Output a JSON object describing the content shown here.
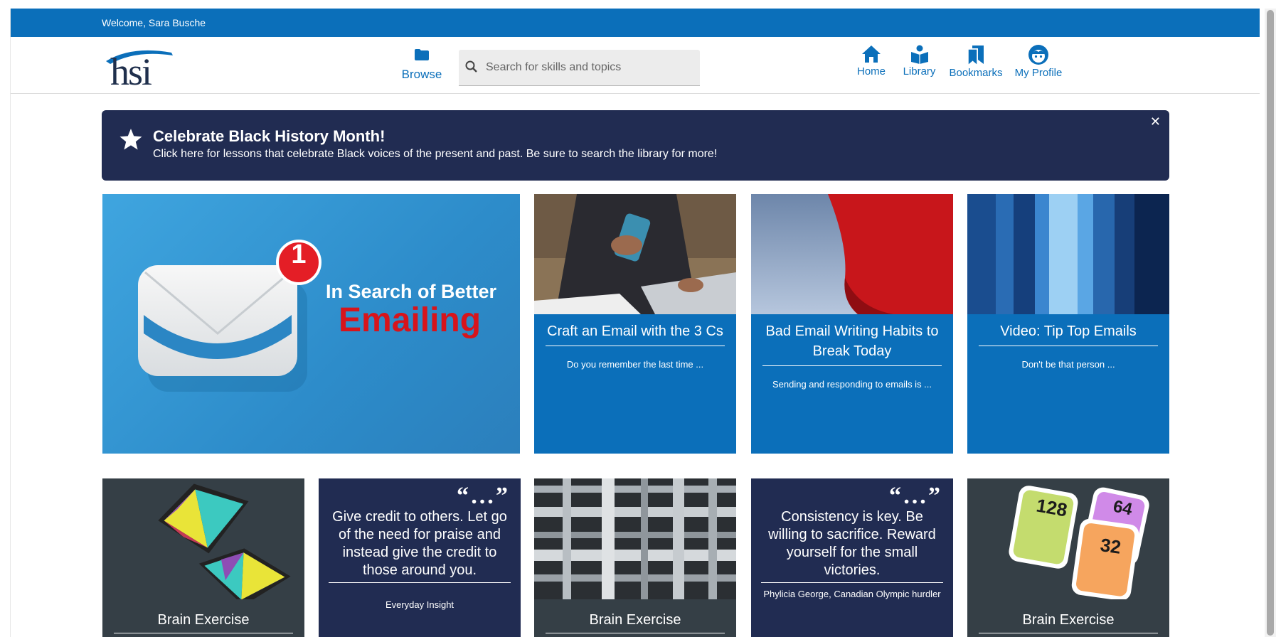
{
  "topbar": {
    "welcome": "Welcome, Sara Busche"
  },
  "logo": {
    "text": "hsi"
  },
  "header": {
    "browse_label": "Browse",
    "search_placeholder": "Search for skills and topics",
    "nav": [
      {
        "label": "Home",
        "icon": "home-icon"
      },
      {
        "label": "Library",
        "icon": "library-icon"
      },
      {
        "label": "Bookmarks",
        "icon": "bookmarks-icon"
      },
      {
        "label": "My Profile",
        "icon": "profile-icon"
      }
    ]
  },
  "banner": {
    "title": "Celebrate Black History Month!",
    "text": "Click here for lessons that celebrate Black voices of the present and past. Be sure to search the library for more!",
    "close": "✕"
  },
  "hero": {
    "line1": "In Search of Better",
    "line2": "Emailing",
    "badge": "1"
  },
  "tiles": [
    {
      "title": "Craft an Email with the 3 Cs",
      "desc": "Do you remember the last time ..."
    },
    {
      "title": "Bad Email Writing Habits to Break Today",
      "desc": "Sending and responding to emails is ..."
    },
    {
      "title": "Video: Tip Top Emails",
      "desc": "Don't be that person ..."
    }
  ],
  "row2": {
    "brain1": {
      "title": "Brain Exercise"
    },
    "quote1": {
      "mark": "“…”",
      "text": "Give credit to others. Let go of the need for praise and instead give the credit to those around you.",
      "author": "Everyday Insight"
    },
    "brain2": {
      "title": "Brain Exercise"
    },
    "quote2": {
      "mark": "“…”",
      "text": "Consistency is key. Be willing to sacrifice. Reward yourself for the small victories.",
      "author": "Phylicia George, Canadian Olympic hurdler"
    },
    "brain3": {
      "title": "Brain Exercise",
      "tiles": [
        "128",
        "64",
        "32"
      ]
    }
  },
  "colors": {
    "primary": "#0b6fba",
    "navy": "#212c52",
    "slate": "#353f46"
  }
}
